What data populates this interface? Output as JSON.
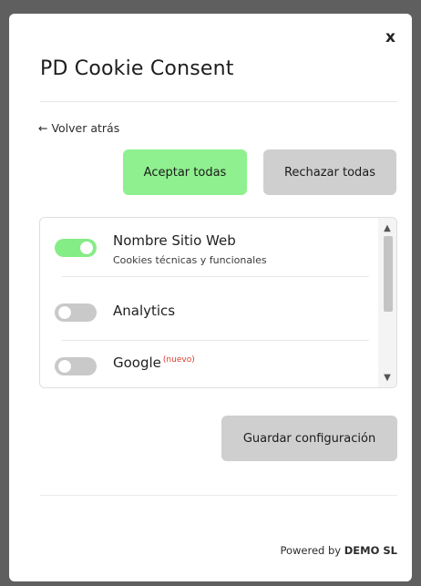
{
  "modal": {
    "close_label": "x",
    "title": "PD Cookie Consent",
    "back_label": "← Volver atrás"
  },
  "actions": {
    "accept_all_label": "Aceptar todas",
    "reject_all_label": "Rechazar todas",
    "save_label": "Guardar configuración"
  },
  "categories": [
    {
      "label": "Nombre Sitio Web",
      "description": "Cookies técnicas y funcionales",
      "enabled": true
    },
    {
      "label": "Analytics",
      "enabled": false
    },
    {
      "label": "Google",
      "badge": "(nuevo)",
      "enabled": false
    }
  ],
  "footer": {
    "powered_prefix": "Powered by",
    "company": "DEMO SL"
  },
  "colors": {
    "accent_green": "#8ff08f",
    "toggle_on": "#85ed85",
    "toggle_off": "#c9c9c9",
    "neutral_button": "#cfcfcf",
    "badge_red": "#e03a2f"
  }
}
